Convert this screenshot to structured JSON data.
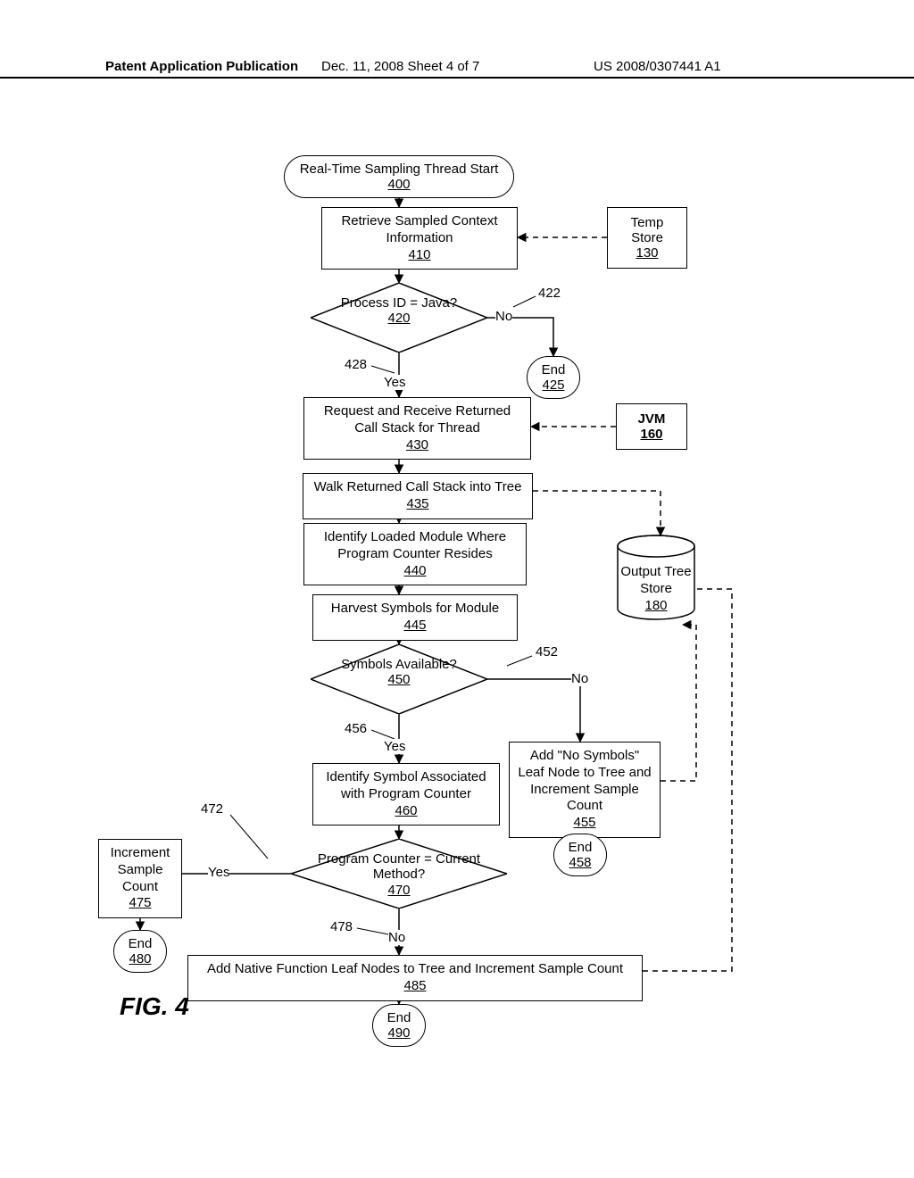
{
  "header": {
    "left": "Patent Application Publication",
    "mid": "Dec. 11, 2008  Sheet 4 of 7",
    "right": "US 2008/0307441 A1"
  },
  "figure_label": "FIG. 4",
  "nodes": {
    "start": {
      "text": "Real-Time Sampling Thread Start",
      "ref": "400"
    },
    "n410": {
      "text": "Retrieve Sampled Context Information",
      "ref": "410"
    },
    "tempStore": {
      "text": "Temp Store",
      "ref": "130"
    },
    "d420": {
      "text": "Process ID = Java?",
      "ref": "420"
    },
    "e425": {
      "text": "End",
      "ref": "425"
    },
    "n430": {
      "text": "Request and Receive Returned Call Stack for Thread",
      "ref": "430"
    },
    "jvm": {
      "text": "JVM",
      "ref": "160"
    },
    "n435": {
      "text": "Walk Returned Call Stack into Tree",
      "ref": "435"
    },
    "ots": {
      "text": "Output Tree Store",
      "ref": "180"
    },
    "n440": {
      "text": "Identify Loaded Module Where Program Counter Resides",
      "ref": "440"
    },
    "n445": {
      "text": "Harvest Symbols for Module",
      "ref": "445"
    },
    "d450": {
      "text": "Symbols Available?",
      "ref": "450"
    },
    "n455": {
      "text": "Add \"No Symbols\" Leaf Node to Tree and Increment Sample Count",
      "ref": "455"
    },
    "e458": {
      "text": "End",
      "ref": "458"
    },
    "n460": {
      "text": "Identify Symbol Associated with Program Counter",
      "ref": "460"
    },
    "d470": {
      "text": "Program Counter = Current Method?",
      "ref": "470"
    },
    "n475": {
      "text": "Increment Sample Count",
      "ref": "475"
    },
    "e480": {
      "text": "End",
      "ref": "480"
    },
    "n485": {
      "text": "Add Native Function Leaf Nodes to Tree and Increment Sample Count",
      "ref": "485"
    },
    "e490": {
      "text": "End",
      "ref": "490"
    }
  },
  "labels": {
    "no422": "No",
    "yes428": "Yes",
    "no452": "No",
    "yes456": "Yes",
    "yes472": "Yes",
    "no478": "No"
  },
  "refs": {
    "r422": "422",
    "r428": "428",
    "r452": "452",
    "r456": "456",
    "r472": "472",
    "r478": "478"
  }
}
